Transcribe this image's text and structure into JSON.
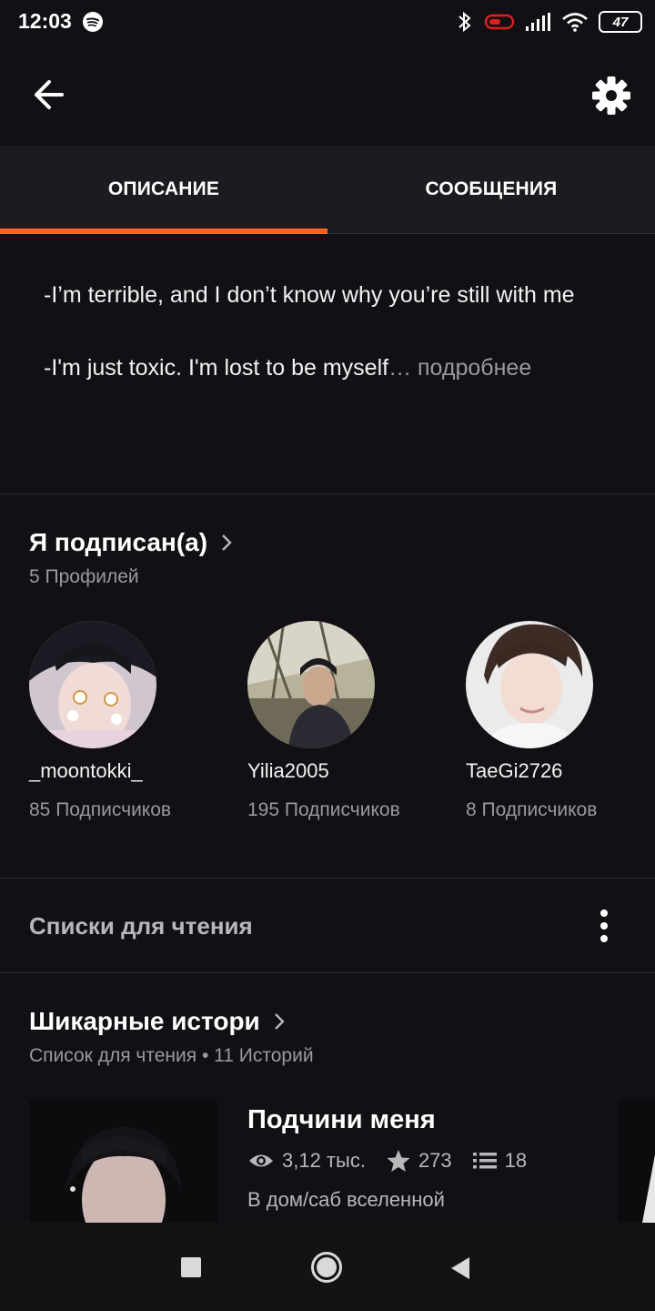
{
  "status_bar": {
    "time": "12:03",
    "battery": "47"
  },
  "header": {
    "back_icon": "arrow-left-icon",
    "settings_icon": "gear-icon"
  },
  "tabs": [
    {
      "label": "ОПИСАНИЕ",
      "active": true
    },
    {
      "label": "СООБЩЕНИЯ",
      "active": false
    }
  ],
  "description": {
    "line1": "-I’m terrible, and I don’t know why you’re still with me",
    "line2": "-I'm just toxic. I'm lost to be myself",
    "more": "… подробнее"
  },
  "following": {
    "title": "Я подписан(а)",
    "subtitle": "5 Профилей",
    "profiles": [
      {
        "name": "_moontokki_",
        "followers": "85 Подписчиков"
      },
      {
        "name": "Yilia2005",
        "followers": "195 Подписчиков"
      },
      {
        "name": "TaeGi2726",
        "followers": "8 Подписчиков"
      }
    ]
  },
  "reading_lists": {
    "label": "Списки для чтения",
    "list": {
      "title": "Шикарные истори",
      "subtitle": "Список для чтения • 11 Историй",
      "story": {
        "title": "Подчини меня",
        "views": "3,12 тыс.",
        "votes": "273",
        "parts": "18",
        "description": "В дом/саб вселенной"
      }
    }
  },
  "colors": {
    "background": "#121014",
    "accent": "#ff6122",
    "muted_text": "#9a999c"
  }
}
